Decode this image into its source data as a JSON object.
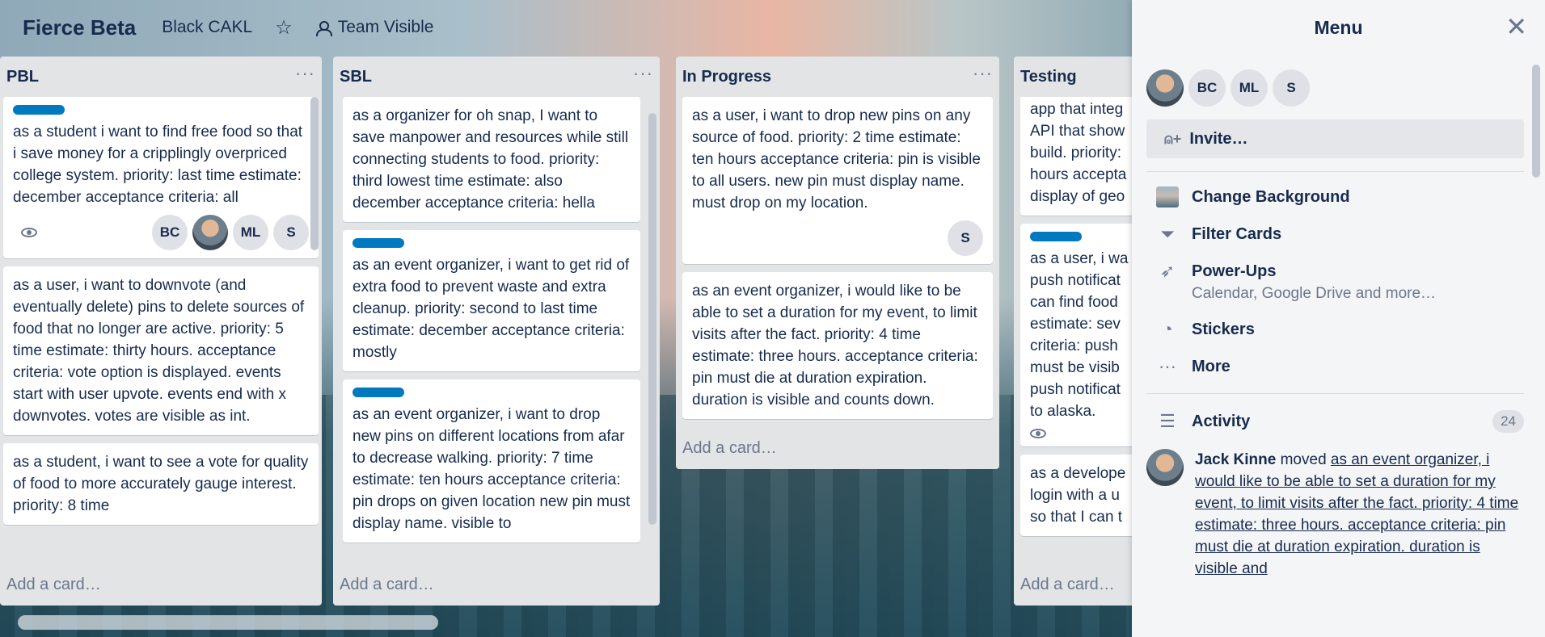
{
  "header": {
    "board_title": "Fierce Beta",
    "team": "Black CAKL",
    "visibility": "Team Visible",
    "icons": {
      "star": "star-icon",
      "visibility": "person-icon"
    }
  },
  "lists": [
    {
      "title": "PBL",
      "add_card": "Add a card…",
      "cards": [
        {
          "label": true,
          "text": "as a student i want to find free food so that i save money for a cripplingly overpriced college system. priority: last time estimate: december acceptance criteria: all",
          "watch": true,
          "members": [
            "BC",
            "photo",
            "ML",
            "S"
          ]
        },
        {
          "label": false,
          "text": "as a user, i want to downvote (and eventually delete) pins to delete sources of food that no longer are active. priority: 5 time estimate: thirty hours. acceptance criteria: vote option is displayed. events start with user upvote. events end with x downvotes. votes are visible as int."
        },
        {
          "label": false,
          "text": "as a student, i want to see a vote for quality of food to more accurately gauge interest. priority: 8 time"
        }
      ]
    },
    {
      "title": "SBL",
      "add_card": "Add a card…",
      "cards": [
        {
          "label": false,
          "text": "as a organizer for oh snap, I want to save manpower and resources while still connecting students to food. priority: third lowest time estimate: also december acceptance criteria: hella"
        },
        {
          "label": true,
          "text": "as an event organizer, i want to get rid of extra food to prevent waste and extra cleanup. priority: second to last time estimate: december acceptance criteria: mostly"
        },
        {
          "label": true,
          "text": "as an event organizer, i want to drop new pins on different locations from afar to decrease walking. priority: 7 time estimate: ten hours acceptance criteria: pin drops on given location new pin must display name. visible to"
        }
      ]
    },
    {
      "title": "In Progress",
      "add_card": "Add a card…",
      "cards": [
        {
          "label": false,
          "text": "as a user, i want to drop new pins on any source of food. priority: 2 time estimate: ten hours acceptance criteria: pin is visible to all users. new pin must display name. must drop on my location.",
          "members": [
            "S"
          ]
        },
        {
          "label": false,
          "text": "as an event organizer, i would like to be able to set a duration for my event, to limit visits after the fact. priority: 4 time estimate: three hours. acceptance criteria: pin must die at duration expiration. duration is visible and counts down."
        }
      ]
    },
    {
      "title": "Testing",
      "add_card": "Add a card…",
      "cards": [
        {
          "label": false,
          "text": "app that integ API that show build. priority: hours accepta display of geo"
        },
        {
          "label": true,
          "text": "as a user, i wa push notificat can find food estimate: sev criteria: push must be visib push notificat to alaska.",
          "watch": true
        },
        {
          "label": false,
          "text": "as a develope login with a u so that I can t"
        }
      ]
    }
  ],
  "menu": {
    "title": "Menu",
    "members": [
      "photo",
      "BC",
      "ML",
      "S"
    ],
    "invite": "Invite…",
    "items": [
      {
        "label": "Change Background",
        "icon": "background-thumbnail-icon"
      },
      {
        "label": "Filter Cards",
        "icon": "filter-icon"
      },
      {
        "label": "Power-Ups",
        "sub": "Calendar, Google Drive and more…",
        "icon": "rocket-icon"
      },
      {
        "label": "Stickers",
        "icon": "sticker-icon"
      },
      {
        "label": "More",
        "icon": "more-icon"
      }
    ],
    "activity": {
      "title": "Activity",
      "count": "24",
      "entry_user": "Jack Kinne",
      "entry_action": "moved",
      "entry_link": "as an event organizer, i would like to be able to set a duration for my event, to limit visits after the fact. priority: 4 time estimate: three hours. acceptance criteria: pin must die at duration expiration. duration is visible and"
    }
  }
}
